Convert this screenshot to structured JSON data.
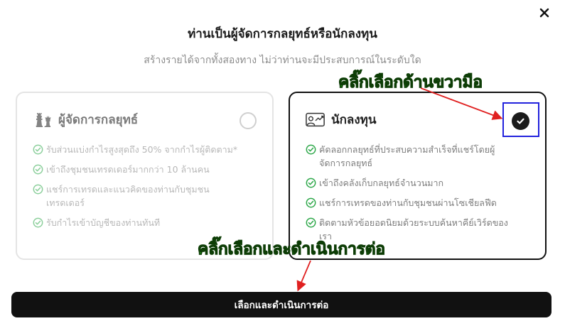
{
  "dialog": {
    "title": "ท่านเป็นผู้จัดการกลยุทธ์หรือนักลงทุน",
    "subtitle": "สร้างรายได้จากทั้งสองทาง ไม่ว่าท่านจะมีประสบการณ์ในระดับใด",
    "close_icon": "close-icon"
  },
  "options": {
    "manager": {
      "title": "ผู้จัดการกลยุทธ์",
      "icon": "chess-pieces-icon",
      "selected": false,
      "features": [
        "รับส่วนแบ่งกำไรสูงสุดถึง 50% จากกำไรผู้ติดตาม*",
        "เข้าถึงชุมชนเทรดเดอร์มากกว่า 10 ล้านคน",
        "แชร์การเทรดและแนวคิดของท่านกับชุมชนเทรดเดอร์",
        "รับกำไรเข้าบัญชีของท่านทันที"
      ]
    },
    "investor": {
      "title": "นักลงทุน",
      "icon": "investor-chart-icon",
      "selected": true,
      "features": [
        "คัดลอกกลยุทธ์ที่ประสบความสำเร็จที่แชร์โดยผู้จัดการกลยุทธ์",
        "เข้าถึงคลังเก็บกลยุทธ์จำนวนมาก",
        "แชร์การเทรดของท่านกับชุมชนผ่านโซเชียลฟีด",
        "ติดตามหัวข้อยอดนิยมด้วยระบบค้นหาคีย์เวิร์ดของเรา"
      ]
    }
  },
  "annotations": {
    "select_right": "คลิ๊กเลือกด้านขวามือ",
    "select_continue": "คลิ๊กเลือกและดำเนินการต่อ"
  },
  "footer": {
    "continue_label": "เลือกและดำเนินการต่อ"
  },
  "colors": {
    "check_green": "#2ea84a",
    "annotation_green": "#22c414",
    "arrow_red": "#e02020",
    "highlight_blue": "#2222dd",
    "button_dark": "#111111"
  }
}
